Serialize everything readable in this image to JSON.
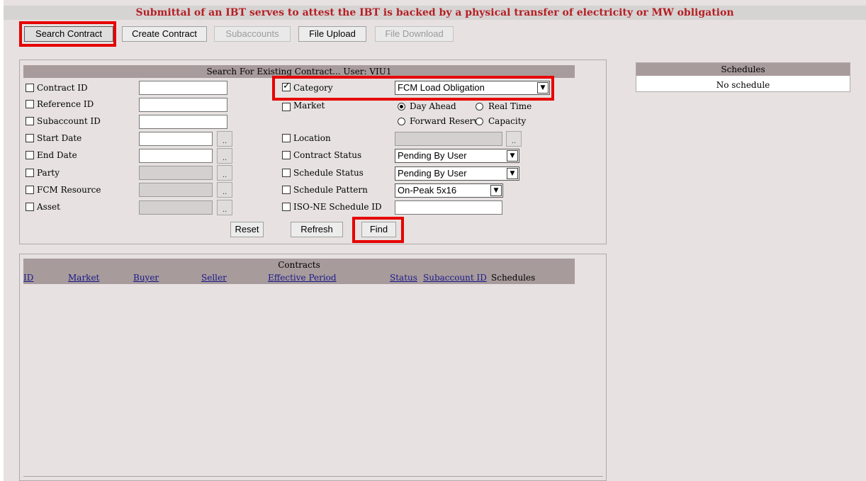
{
  "banner": "Submittal of an IBT serves to attest the IBT is backed by a physical transfer of electricity or MW obligation",
  "toolbar": {
    "search_contract": "Search Contract",
    "create_contract": "Create Contract",
    "subaccounts": "Subaccounts",
    "file_upload": "File Upload",
    "file_download": "File Download"
  },
  "search": {
    "header": "Search For Existing Contract... User: VIU1",
    "left_fields": {
      "contract_id": "Contract ID",
      "reference_id": "Reference ID",
      "subaccount_id": "Subaccount ID",
      "start_date": "Start Date",
      "end_date": "End  Date",
      "party": "Party",
      "fcm_resource": "FCM Resource",
      "asset": "Asset"
    },
    "right_fields": {
      "category": "Category",
      "category_value": "FCM Load Obligation",
      "market": "Market",
      "market_options": {
        "day_ahead": "Day Ahead",
        "real_time": "Real Time",
        "forward_reserve": "Forward Reserve",
        "capacity": "Capacity"
      },
      "market_selected": "Day Ahead",
      "location": "Location",
      "contract_status": "Contract Status",
      "contract_status_value": "Pending By User",
      "schedule_status": "Schedule Status",
      "schedule_status_value": "Pending By User",
      "schedule_pattern": "Schedule Pattern",
      "schedule_pattern_value": "On-Peak 5x16",
      "iso_ne_schedule_id": "ISO-NE Schedule ID"
    },
    "dots": "..",
    "reset": "Reset",
    "refresh": "Refresh",
    "find": "Find"
  },
  "contracts": {
    "header": "Contracts",
    "columns": [
      "ID",
      "Market",
      "Buyer",
      "Seller",
      "Effective Period",
      "Status",
      "Subaccount ID",
      "Schedules"
    ]
  },
  "schedules": {
    "header": "Schedules",
    "empty": "No schedule"
  },
  "colors": {
    "banner_text": "#b41f24",
    "background": "#e7e1e1",
    "header_bar": "#a89b9b",
    "highlight": "#e60000",
    "link": "#1a1a8c"
  }
}
